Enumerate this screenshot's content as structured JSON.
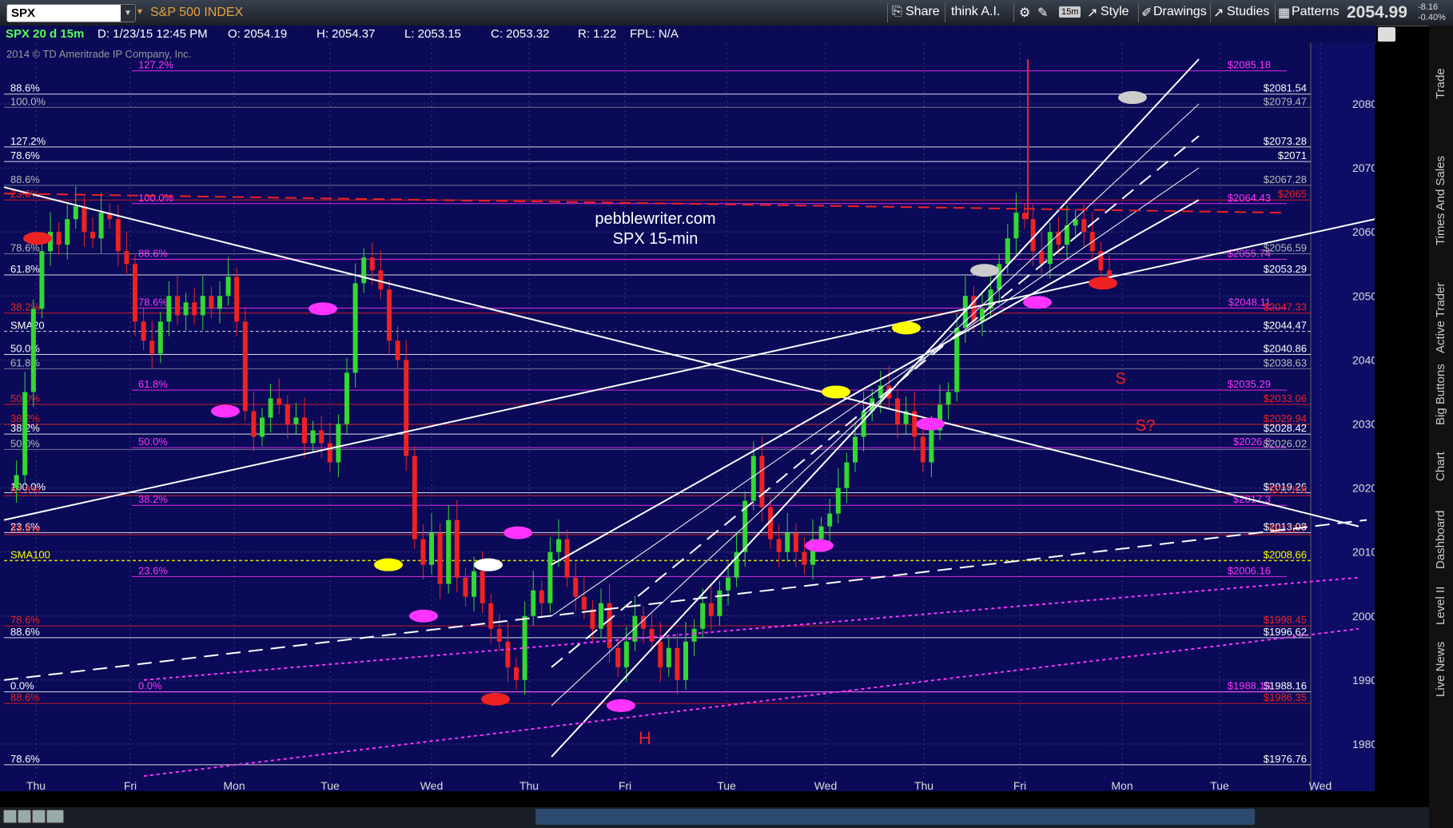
{
  "toolbar": {
    "symbol": "SPX",
    "index_name": "S&P 500 INDEX",
    "share": "Share",
    "think_ai": "think A.I.",
    "interval": "15m",
    "style": "Style",
    "drawings": "Drawings",
    "studies": "Studies",
    "patterns": "Patterns",
    "last_price": "2054.99",
    "change": "-8.16",
    "change_pct": "-0.40%"
  },
  "info_bar": {
    "title": "SPX 20 d 15m",
    "date": "D: 1/23/15 12:45 PM",
    "open": "O: 2054.19",
    "high": "H: 2054.37",
    "low": "L: 2053.15",
    "close": "C: 2053.32",
    "range": "R: 1.22",
    "fpl": "FPL: N/A"
  },
  "side_tabs": [
    "Trade",
    "Times And Sales",
    "Active Trader",
    "Big Buttons",
    "Chart",
    "Dashboard",
    "Level II",
    "Live News"
  ],
  "colors": {
    "background": "#0a0a58",
    "candle_up": "#33d833",
    "candle_down": "#ee2222",
    "white": "#ffffff",
    "magenta": "#ff33ff",
    "red": "#ee2222",
    "yellow": "#ffff00",
    "grid": "#3a3a7a"
  },
  "chart_data": {
    "type": "candlestick",
    "symbol": "SPX",
    "interval": "15m",
    "copyright": "2014 © TD Ameritrade IP Company, Inc.",
    "watermark": [
      "pebblewriter.com",
      "SPX 15-min"
    ],
    "ylim": [
      1971,
      2087
    ],
    "y_ticks": [
      1980,
      1990,
      2000,
      2010,
      2020,
      2030,
      2040,
      2050,
      2060,
      2070,
      2080
    ],
    "x_ticks": [
      "Thu",
      "Fri",
      "Mon",
      "Tue",
      "Wed",
      "Thu",
      "Fri",
      "Tue",
      "Wed",
      "Thu",
      "Fri",
      "Mon",
      "Tue",
      "Wed"
    ],
    "last_price_label": "2053.32",
    "path": [
      [
        0,
        2020
      ],
      [
        1,
        2022
      ],
      [
        2,
        2035
      ],
      [
        3,
        2048
      ],
      [
        4,
        2057
      ],
      [
        5,
        2060
      ],
      [
        6,
        2058
      ],
      [
        7,
        2062
      ],
      [
        8,
        2064
      ],
      [
        9,
        2060
      ],
      [
        10,
        2059
      ],
      [
        11,
        2063
      ],
      [
        12,
        2062
      ],
      [
        13,
        2057
      ],
      [
        14,
        2055
      ],
      [
        15,
        2046
      ],
      [
        16,
        2043
      ],
      [
        17,
        2041
      ],
      [
        18,
        2046
      ],
      [
        19,
        2050
      ],
      [
        20,
        2047
      ],
      [
        21,
        2049
      ],
      [
        22,
        2047
      ],
      [
        23,
        2050
      ],
      [
        24,
        2048
      ],
      [
        25,
        2050
      ],
      [
        26,
        2053
      ],
      [
        27,
        2046
      ],
      [
        28,
        2032
      ],
      [
        29,
        2028
      ],
      [
        30,
        2031
      ],
      [
        31,
        2034
      ],
      [
        32,
        2033
      ],
      [
        33,
        2030
      ],
      [
        34,
        2031
      ],
      [
        35,
        2027
      ],
      [
        36,
        2029
      ],
      [
        37,
        2027
      ],
      [
        38,
        2024
      ],
      [
        39,
        2030
      ],
      [
        40,
        2038
      ],
      [
        41,
        2052
      ],
      [
        42,
        2056
      ],
      [
        43,
        2054
      ],
      [
        44,
        2051
      ],
      [
        45,
        2043
      ],
      [
        46,
        2040
      ],
      [
        47,
        2025
      ],
      [
        48,
        2012
      ],
      [
        49,
        2008
      ],
      [
        50,
        2013
      ],
      [
        51,
        2005
      ],
      [
        52,
        2015
      ],
      [
        53,
        2006
      ],
      [
        54,
        2003
      ],
      [
        55,
        2007
      ],
      [
        56,
        2002
      ],
      [
        57,
        1998
      ],
      [
        58,
        1996
      ],
      [
        59,
        1992
      ],
      [
        60,
        1990
      ],
      [
        61,
        2000
      ],
      [
        62,
        2004
      ],
      [
        63,
        2002
      ],
      [
        64,
        2010
      ],
      [
        65,
        2012
      ],
      [
        66,
        2006
      ],
      [
        67,
        2003
      ],
      [
        68,
        2001
      ],
      [
        69,
        1998
      ],
      [
        70,
        2002
      ],
      [
        71,
        1995
      ],
      [
        72,
        1992
      ],
      [
        73,
        1996
      ],
      [
        74,
        2000
      ],
      [
        75,
        1998
      ],
      [
        76,
        1996
      ],
      [
        77,
        1992
      ],
      [
        78,
        1995
      ],
      [
        79,
        1990
      ],
      [
        80,
        1996
      ],
      [
        81,
        1998
      ],
      [
        82,
        2002
      ],
      [
        83,
        2000
      ],
      [
        84,
        2004
      ],
      [
        85,
        2006
      ],
      [
        86,
        2010
      ],
      [
        87,
        2018
      ],
      [
        88,
        2025
      ],
      [
        89,
        2017
      ],
      [
        90,
        2012
      ],
      [
        91,
        2010
      ],
      [
        92,
        2013
      ],
      [
        93,
        2010
      ],
      [
        94,
        2008
      ],
      [
        95,
        2012
      ],
      [
        96,
        2014
      ],
      [
        97,
        2016
      ],
      [
        98,
        2020
      ],
      [
        99,
        2024
      ],
      [
        100,
        2028
      ],
      [
        101,
        2032
      ],
      [
        102,
        2034
      ],
      [
        103,
        2036
      ],
      [
        104,
        2034
      ],
      [
        105,
        2030
      ],
      [
        106,
        2032
      ],
      [
        107,
        2028
      ],
      [
        108,
        2024
      ],
      [
        109,
        2029
      ],
      [
        110,
        2033
      ],
      [
        111,
        2035
      ],
      [
        112,
        2045
      ],
      [
        113,
        2050
      ],
      [
        114,
        2046
      ],
      [
        115,
        2048
      ],
      [
        116,
        2051
      ],
      [
        117,
        2055
      ],
      [
        118,
        2059
      ],
      [
        119,
        2063
      ],
      [
        120,
        2062
      ],
      [
        121,
        2057
      ],
      [
        122,
        2055
      ],
      [
        123,
        2060
      ],
      [
        124,
        2058
      ],
      [
        125,
        2061
      ],
      [
        126,
        2062
      ],
      [
        127,
        2060
      ],
      [
        128,
        2057
      ],
      [
        129,
        2054
      ],
      [
        130,
        2053
      ]
    ],
    "horizontal_levels": [
      {
        "left": "127.2%",
        "right": "$2085.18",
        "value": 2085.18,
        "color": "#ff33ff"
      },
      {
        "left": "88.6%",
        "right": "$2081.54",
        "value": 2081.54,
        "color": "#ffffff"
      },
      {
        "left": "100.0%",
        "right": "$2079.47",
        "value": 2079.47,
        "color": "#bbbbbb"
      },
      {
        "left": "127.2%",
        "right": "$2073.28",
        "value": 2073.28,
        "color": "#ffffff"
      },
      {
        "left": "78.6%",
        "right": "$2071",
        "value": 2071,
        "color": "#ffffff"
      },
      {
        "left": "88.6%",
        "right": "$2067.28",
        "value": 2067.28,
        "color": "#bbbbbb"
      },
      {
        "left": "23.6%",
        "right": "$2065",
        "value": 2065,
        "color": "#ee2222"
      },
      {
        "left": "100.0%",
        "right": "$2064.43",
        "value": 2064.43,
        "color": "#ff33ff"
      },
      {
        "left": "88.6%",
        "right": "$2055.74",
        "value": 2055.74,
        "color": "#ff33ff"
      },
      {
        "left": "78.6%",
        "right": "$2056.59",
        "value": 2056.59,
        "color": "#bbbbbb"
      },
      {
        "left": "61.8%",
        "right": "$2053.29",
        "value": 2053.29,
        "color": "#ffffff"
      },
      {
        "left": "78.6%",
        "right": "$2048.11",
        "value": 2048.11,
        "color": "#ff33ff"
      },
      {
        "left": "38.2%",
        "right": "$2047.33",
        "value": 2047.33,
        "color": "#ee2222"
      },
      {
        "left": "SMA20",
        "right": "$2044.47",
        "value": 2044.47,
        "color": "#ffffff"
      },
      {
        "left": "50.0%",
        "right": "$2040.86",
        "value": 2040.86,
        "color": "#ffffff"
      },
      {
        "left": "61.8%",
        "right": "$2038.63",
        "value": 2038.63,
        "color": "#bbbbbb"
      },
      {
        "left": "61.8%",
        "right": "$2035.29",
        "value": 2035.29,
        "color": "#ff33ff"
      },
      {
        "left": "50.0%",
        "right": "$2033.06",
        "value": 2033.06,
        "color": "#ee2222"
      },
      {
        "left": "38.2%",
        "right": "$2029.94",
        "value": 2029.94,
        "color": "#ee2222"
      },
      {
        "left": "38.2%",
        "right": "$2028.42",
        "value": 2028.42,
        "color": "#ffffff"
      },
      {
        "left": "50.0%",
        "right": "$2026.3",
        "value": 2026.3,
        "color": "#ff33ff"
      },
      {
        "left": "50.0%",
        "right": "$2026.02",
        "value": 2026.02,
        "color": "#bbbbbb"
      },
      {
        "left": "100.0%",
        "right": "$2019.26",
        "value": 2019.26,
        "color": "#ffffff"
      },
      {
        "left": "61.8%",
        "right": "$2018.8",
        "value": 2018.8,
        "color": "#ee2222"
      },
      {
        "left": "38.2%",
        "right": "$2017.3",
        "value": 2017.3,
        "color": "#ff33ff"
      },
      {
        "left": "23.6%",
        "right": "$2013.03",
        "value": 2013.03,
        "color": "#ffffff"
      },
      {
        "left": "23.6%",
        "right": "$2012.7",
        "value": 2012.7,
        "color": "#ee2222"
      },
      {
        "left": "SMA100",
        "right": "$2008.66",
        "value": 2008.66,
        "color": "#ffff00"
      },
      {
        "left": "23.6%",
        "right": "$2006.16",
        "value": 2006.16,
        "color": "#ff33ff"
      },
      {
        "left": "78.6%",
        "right": "$1998.45",
        "value": 1998.45,
        "color": "#ee2222"
      },
      {
        "left": "88.6%",
        "right": "$1996.62",
        "value": 1996.62,
        "color": "#ffffff"
      },
      {
        "left": "0.0%",
        "right": "$1988.16",
        "value": 1988.16,
        "color": "#ffffff"
      },
      {
        "left": "0.0%",
        "right": "$1988.16",
        "value": 1988.16,
        "color": "#ff33ff"
      },
      {
        "left": "88.6%",
        "right": "$1986.35",
        "value": 1986.35,
        "color": "#ee2222"
      },
      {
        "left": "78.6%",
        "right": "$1976.76",
        "value": 1976.76,
        "color": "#ffffff"
      }
    ],
    "annotations": [
      "H",
      "S",
      "S?"
    ]
  }
}
